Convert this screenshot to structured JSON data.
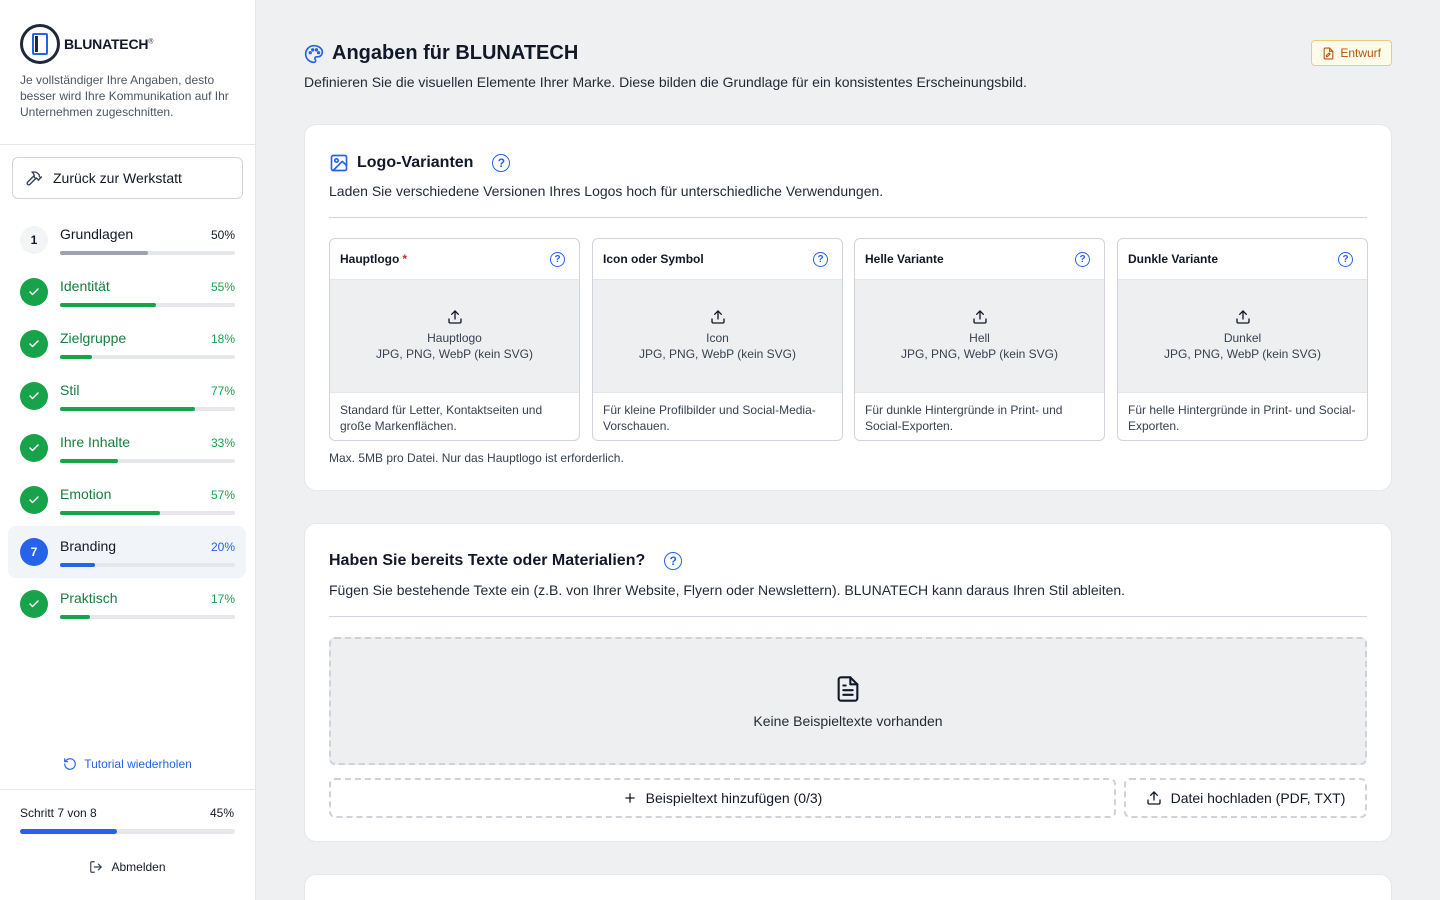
{
  "brand": {
    "name": "BLUNATECH",
    "reg": "®"
  },
  "sidebar": {
    "intro": "Je vollständiger Ihre Angaben, desto besser wird Ihre Kommunikation auf Ihr Unternehmen zugeschnitten.",
    "back_label": "Zurück zur Werkstatt",
    "steps": [
      {
        "badge": "1",
        "label": "Grundlagen",
        "pct": "50%",
        "progress": 0.5,
        "state": "number",
        "color": "#9ca3af"
      },
      {
        "badge": "",
        "label": "Identität",
        "pct": "55%",
        "progress": 0.55,
        "state": "done",
        "color": "#16a34a"
      },
      {
        "badge": "",
        "label": "Zielgruppe",
        "pct": "18%",
        "progress": 0.18,
        "state": "done",
        "color": "#16a34a"
      },
      {
        "badge": "",
        "label": "Stil",
        "pct": "77%",
        "progress": 0.77,
        "state": "done",
        "color": "#16a34a"
      },
      {
        "badge": "",
        "label": "Ihre Inhalte",
        "pct": "33%",
        "progress": 0.33,
        "state": "done",
        "color": "#16a34a"
      },
      {
        "badge": "",
        "label": "Emotion",
        "pct": "57%",
        "progress": 0.57,
        "state": "done",
        "color": "#16a34a"
      },
      {
        "badge": "7",
        "label": "Branding",
        "pct": "20%",
        "progress": 0.2,
        "state": "current",
        "color": "#2563eb"
      },
      {
        "badge": "",
        "label": "Praktisch",
        "pct": "17%",
        "progress": 0.17,
        "state": "done",
        "color": "#16a34a"
      }
    ],
    "tutorial_label": "Tutorial wiederholen",
    "progress_label": "Schritt 7 von 8",
    "progress_pct": "45%",
    "progress_value": 0.45,
    "logout_label": "Abmelden"
  },
  "main": {
    "title": "Angaben für BLUNATECH",
    "subtitle": "Definieren Sie die visuellen Elemente Ihrer Marke. Diese bilden die Grundlage für ein konsistentes Erscheinungsbild.",
    "status_badge": "Entwurf",
    "logo_card": {
      "title": "Logo-Varianten",
      "description": "Laden Sie verschiedene Versionen Ihres Logos hoch für unterschiedliche Verwendungen.",
      "boxes": [
        {
          "title": "Hauptlogo",
          "required": "*",
          "drop_title": "Hauptlogo",
          "formats": "JPG, PNG, WebP (kein SVG)",
          "note": "Standard für Letter, Kontaktseiten und große Markenflächen."
        },
        {
          "title": "Icon oder Symbol",
          "required": "",
          "drop_title": "Icon",
          "formats": "JPG, PNG, WebP (kein SVG)",
          "note": "Für kleine Profilbilder und Social-Media-Vorschauen."
        },
        {
          "title": "Helle Variante",
          "required": "",
          "drop_title": "Hell",
          "formats": "JPG, PNG, WebP (kein SVG)",
          "note": "Für dunkle Hintergründe in Print- und Social-Exporten."
        },
        {
          "title": "Dunkle Variante",
          "required": "",
          "drop_title": "Dunkel",
          "formats": "JPG, PNG, WebP (kein SVG)",
          "note": "Für helle Hintergründe in Print- und Social-Exporten."
        }
      ],
      "footnote": "Max. 5MB pro Datei. Nur das Hauptlogo ist erforderlich."
    },
    "texts_card": {
      "title": "Haben Sie bereits Texte oder Materialien?",
      "description": "Fügen Sie bestehende Texte ein (z.B. von Ihrer Website, Flyern oder Newslettern). BLUNATECH kann daraus Ihren Stil ableiten.",
      "empty_label": "Keine Beispieltexte vorhanden",
      "add_label": "Beispieltext hinzufügen (0/3)",
      "upload_label": "Datei hochladen (PDF, TXT)"
    },
    "help_glyph": "?"
  }
}
